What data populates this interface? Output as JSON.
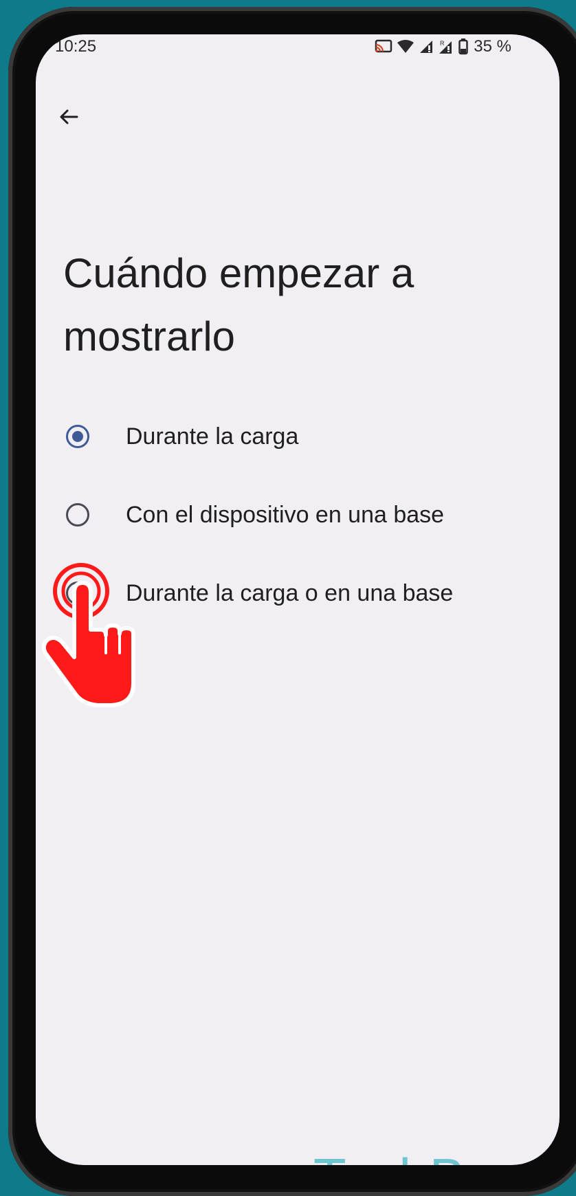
{
  "status_bar": {
    "time": "10:25",
    "battery": "35 %",
    "icons": [
      "cast-icon",
      "wifi-icon",
      "signal-icon",
      "roaming-signal-icon",
      "battery-icon"
    ]
  },
  "header": {
    "back_icon": "arrow-left-icon"
  },
  "page": {
    "title": "Cuándo empezar a mostrarlo"
  },
  "options": [
    {
      "label": "Durante la carga",
      "selected": true
    },
    {
      "label": "Con el dispositivo en una base",
      "selected": false
    },
    {
      "label": "Durante la carga o en una base",
      "selected": false
    }
  ],
  "overlay": {
    "tap_indicator": "tap-hand-icon"
  },
  "watermark": {
    "text": "TechBone"
  },
  "colors": {
    "background": "#0f7a8a",
    "screen": "#f1eff4",
    "radio_selected": "#3d5a97",
    "tap_hand": "#ff1a1a",
    "watermark": "#6ec4cf"
  }
}
